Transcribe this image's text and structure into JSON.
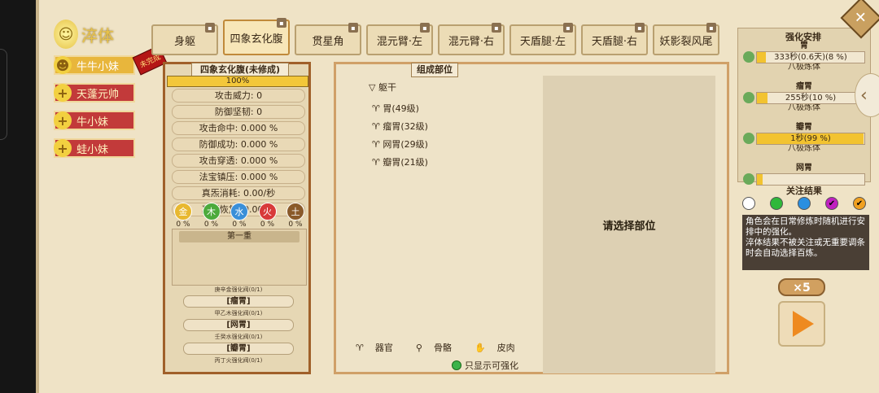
{
  "left": {
    "title": "淬体",
    "characters": [
      {
        "name": "牛牛小妹",
        "selected": true,
        "icon": "head-icon"
      },
      {
        "name": "天蓬元帅",
        "selected": false,
        "icon": "plus-icon"
      },
      {
        "name": "牛小妹",
        "selected": false,
        "icon": "plus-icon"
      },
      {
        "name": "蛙小妹",
        "selected": false,
        "icon": "plus-icon"
      }
    ],
    "seal": "未完成"
  },
  "tabs": [
    {
      "label": "身躯",
      "active": false
    },
    {
      "label": "四象玄化腹",
      "active": true
    },
    {
      "label": "贯星角",
      "active": false
    },
    {
      "label": "混元臂·左",
      "active": false
    },
    {
      "label": "混元臂·右",
      "active": false
    },
    {
      "label": "天盾腿·左",
      "active": false
    },
    {
      "label": "天盾腿·右",
      "active": false
    },
    {
      "label": "妖影裂风尾",
      "active": false
    }
  ],
  "part_panel": {
    "title": "四象玄化腹(未修成)",
    "progress": "100%",
    "stats": [
      "攻击威力: 0",
      "防御坚韧: 0",
      "攻击命中: 0.000 %",
      "防御成功: 0.000 %",
      "攻击穿透: 0.000 %",
      "法宝镇压: 0.000 %",
      "真炁消耗: 0.00/秒",
      "真炁恢复: 0.00/秒"
    ],
    "elements": [
      {
        "label": "金",
        "value": "0 %",
        "color": "#e8b830"
      },
      {
        "label": "木",
        "value": "0 %",
        "color": "#4caa3c"
      },
      {
        "label": "水",
        "value": "0 %",
        "color": "#3a8fd8"
      },
      {
        "label": "火",
        "value": "0 %",
        "color": "#d83a3a"
      },
      {
        "label": "土",
        "value": "0 %",
        "color": "#8a5a2a"
      }
    ],
    "slot_label": "第一重",
    "components": [
      {
        "small": "庚辛金强化阀(0/1)",
        "tag": "[瘤胃]"
      },
      {
        "small": "甲乙木强化阀(0/1)",
        "tag": "[网胃]"
      },
      {
        "small": "壬癸水强化阀(0/1)",
        "tag": "[瓣胃]"
      },
      {
        "small": "丙丁火强化阀(0/1)",
        "tag": ""
      }
    ]
  },
  "component_panel": {
    "title": "组成部位",
    "root": "躯干",
    "items": [
      "胃(49级)",
      "瘤胃(32级)",
      "网胃(29级)",
      "瓣胃(21级)"
    ],
    "detail_placeholder": "请选择部位",
    "legend": [
      "器官",
      "骨骼",
      "皮肉"
    ],
    "filter_label": "只显示可强化"
  },
  "plan_panel": {
    "title": "强化安排",
    "plans": [
      {
        "name": "胃",
        "text": "333秒(0.6天)(8 %)",
        "fill": 0.08,
        "level": "八极炼体"
      },
      {
        "name": "瘤胃",
        "text": "255秒(10 %)",
        "fill": 0.1,
        "level": "八极炼体"
      },
      {
        "name": "瓣胃",
        "text": "1秒(99 %)",
        "fill": 0.99,
        "level": "八极炼体"
      },
      {
        "name": "网胃",
        "text": "",
        "fill": 0.05,
        "level": ""
      }
    ]
  },
  "focus": {
    "title": "关注结果",
    "colors": [
      "#ffffff",
      "#2fb83a",
      "#2a8fe0",
      "#c020c0",
      "#f0a020"
    ],
    "info": "角色会在日常修炼时随机进行安排中的强化。\n淬体结果不被关注或无重要调条时会自动选择百炼。"
  },
  "multiplier": "×5"
}
